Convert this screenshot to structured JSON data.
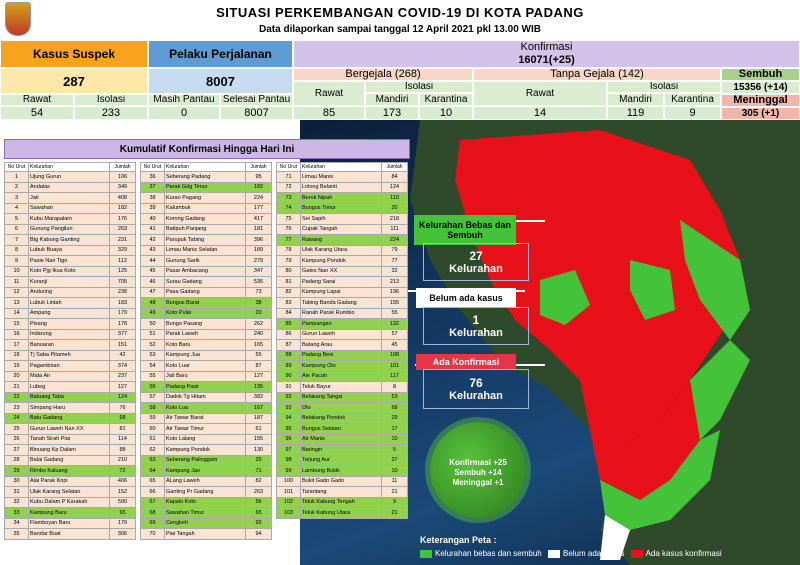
{
  "header": {
    "title": "SITUASI PERKEMBANGAN COVID-19 DI KOTA PADANG",
    "subtitle": "Data dilaporkan sampai tanggal 12 April 2021 pkl 13.00 WIB"
  },
  "stats": {
    "suspek_label": "Kasus Suspek",
    "suspek_value": "287",
    "rawat_label": "Rawat",
    "rawat_value": "54",
    "isolasi_label": "Isolasi",
    "isolasi_value": "233",
    "pp_label": "Pelaku Perjalanan",
    "pp_value": "8007",
    "masih_label": "Masih Pantau",
    "masih_value": "0",
    "selesai_label": "Selesai Pantau",
    "selesai_value": "8007",
    "konf_label": "Konfirmasi",
    "konf_value": "16071(+25)",
    "bergejala_label": "Bergejala (268)",
    "tanpa_label": "Tanpa Gejala (142)",
    "bg_rawat_label": "Rawat",
    "bg_isolasi_label": "Isolasi",
    "bg_mandiri_label": "Mandiri",
    "bg_karantina_label": "Karantina",
    "bg_rawat": "85",
    "bg_mandiri": "173",
    "bg_karantina": "10",
    "tg_rawat_label": "Rawat",
    "tg_isolasi_label": "Isolasi",
    "tg_mandiri_label": "Mandiri",
    "tg_karantina_label": "Karantina",
    "tg_rawat": "14",
    "tg_mandiri": "119",
    "tg_karantina": "9",
    "sembuh_label": "Sembuh",
    "sembuh_value": "15356 (+14)",
    "meninggal_label": "Meninggal",
    "meninggal_value": "305 (+1)"
  },
  "table": {
    "title": "Kumulatif Konfirmasi Hingga Hari Ini",
    "col_no": "No Urut",
    "col_kel": "Kelurahan",
    "col_jml": "Jumlah",
    "rows": [
      [
        "1",
        "Ujung Gurun",
        "106",
        0
      ],
      [
        "2",
        "Andalas",
        "349",
        0
      ],
      [
        "3",
        "Jati",
        "408",
        0
      ],
      [
        "4",
        "Sawahan",
        "182",
        0
      ],
      [
        "5",
        "Kubu Marapalam",
        "176",
        0
      ],
      [
        "6",
        "Gunung Pangilun",
        "263",
        0
      ],
      [
        "7",
        "Btg Kabung Ganting",
        "231",
        0
      ],
      [
        "8",
        "Lubuk Buaya",
        "329",
        0
      ],
      [
        "9",
        "Pasie Nan Tigo",
        "112",
        0
      ],
      [
        "10",
        "Koto Pjg Ikua Koto",
        "125",
        0
      ],
      [
        "11",
        "Kuranji",
        "705",
        0
      ],
      [
        "12",
        "Anduring",
        "238",
        0
      ],
      [
        "13",
        "Lubuk Lintah",
        "183",
        0
      ],
      [
        "14",
        "Ampang",
        "179",
        0
      ],
      [
        "15",
        "Pisang",
        "178",
        0
      ],
      [
        "16",
        "Indarung",
        "377",
        0
      ],
      [
        "17",
        "Banuaran",
        "151",
        0
      ],
      [
        "18",
        "Tj Saba Pitameh",
        "42",
        0
      ],
      [
        "19",
        "Pagambiran",
        "374",
        0
      ],
      [
        "20",
        "Mata Air",
        "237",
        0
      ],
      [
        "21",
        "Lubeg",
        "127",
        0
      ],
      [
        "22",
        "Batuang Taba",
        "124",
        1
      ],
      [
        "23",
        "Simpang Haru",
        "76",
        0
      ],
      [
        "24",
        "Batu Gadang",
        "68",
        1
      ],
      [
        "25",
        "Gurun Laweh Nan XX",
        "81",
        0
      ],
      [
        "26",
        "Tanah Sirah Piai",
        "114",
        0
      ],
      [
        "27",
        "Binuang Kp Dalam",
        "88",
        0
      ],
      [
        "28",
        "Balai Gadang",
        "210",
        0
      ],
      [
        "29",
        "Rimbo Kaluang",
        "72",
        1
      ],
      [
        "30",
        "Alai Parak Kopi",
        "406",
        0
      ],
      [
        "31",
        "Ulak Karang Selatan",
        "152",
        0
      ],
      [
        "32",
        "Kubu Dalam P Karakah",
        "590",
        0
      ],
      [
        "33",
        "Kampung Baru",
        "65",
        1
      ],
      [
        "34",
        "Flamboyan Baru",
        "179",
        0
      ],
      [
        "35",
        "Bandar Buat",
        "306",
        0
      ],
      [
        "36",
        "Seberang Padang",
        "95",
        0
      ],
      [
        "37",
        "Parak Gdg Timur",
        "182",
        1
      ],
      [
        "38",
        "Kurao Pagang",
        "224",
        0
      ],
      [
        "39",
        "Kalumbuk",
        "177",
        0
      ],
      [
        "40",
        "Korong Gadang",
        "417",
        0
      ],
      [
        "41",
        "Batipuh Panjang",
        "181",
        0
      ],
      [
        "42",
        "Parupuk Tabing",
        "396",
        0
      ],
      [
        "43",
        "Limau Manis Selatan",
        "189",
        0
      ],
      [
        "44",
        "Gunung Sarik",
        "279",
        0
      ],
      [
        "45",
        "Pasar Ambacang",
        "347",
        0
      ],
      [
        "46",
        "Surau Gadang",
        "536",
        0
      ],
      [
        "47",
        "Pasa Gadang",
        "73",
        0
      ],
      [
        "48",
        "Bungus Barat",
        "38",
        1
      ],
      [
        "49",
        "Koto Pulai",
        "20",
        1
      ],
      [
        "50",
        "Bungo Pasang",
        "262",
        0
      ],
      [
        "51",
        "Parak Laweh",
        "240",
        0
      ],
      [
        "52",
        "Koto Baru",
        "165",
        0
      ],
      [
        "53",
        "Kampung Jua",
        "55",
        0
      ],
      [
        "54",
        "Koto Luar",
        "87",
        0
      ],
      [
        "55",
        "Jati Baru",
        "127",
        0
      ],
      [
        "56",
        "Padang Pasir",
        "135",
        1
      ],
      [
        "57",
        "Dadok Tg Hitam",
        "382",
        0
      ],
      [
        "58",
        "Koto Lua",
        "167",
        1
      ],
      [
        "59",
        "Air Tawar Barat",
        "187",
        0
      ],
      [
        "60",
        "Air Tawar Timur",
        "61",
        0
      ],
      [
        "61",
        "Koto Lalang",
        "155",
        0
      ],
      [
        "62",
        "Kampung Pondok",
        "130",
        0
      ],
      [
        "63",
        "Seberang Palinggam",
        "25",
        1
      ],
      [
        "64",
        "Kampung Jao",
        "71",
        1
      ],
      [
        "65",
        "ALang Laweh",
        "82",
        0
      ],
      [
        "66",
        "Ganting Pr Gadang",
        "263",
        0
      ],
      [
        "67",
        "Kapalo Koto",
        "56",
        1
      ],
      [
        "68",
        "Sawahan Timur",
        "65",
        1
      ],
      [
        "69",
        "Cengkeh",
        "92",
        1
      ],
      [
        "70",
        "Piai Tangah",
        "94",
        0
      ],
      [
        "71",
        "Limau Manis",
        "84",
        0
      ],
      [
        "72",
        "Lolong Belanti",
        "124",
        0
      ],
      [
        "73",
        "Berok Nipah",
        "110",
        1
      ],
      [
        "74",
        "Bungus Timur",
        "20",
        1
      ],
      [
        "75",
        "Sei Sapih",
        "218",
        0
      ],
      [
        "76",
        "Cupak Tangah",
        "111",
        0
      ],
      [
        "77",
        "Rawang",
        "224",
        1
      ],
      [
        "78",
        "Ulak Karang Utara",
        "79",
        0
      ],
      [
        "79",
        "Kampung Pondok",
        "77",
        0
      ],
      [
        "80",
        "Gates Nan XX",
        "32",
        0
      ],
      [
        "81",
        "Padang Sarai",
        "213",
        0
      ],
      [
        "82",
        "Kampung Lapai",
        "196",
        0
      ],
      [
        "83",
        "Tabing Banda Gadang",
        "155",
        0
      ],
      [
        "84",
        "Ranah Parak Rumbio",
        "55",
        0
      ],
      [
        "85",
        "Pampangan",
        "132",
        1
      ],
      [
        "86",
        "Gurun Laweh",
        "57",
        0
      ],
      [
        "87",
        "Batang Arau",
        "45",
        0
      ],
      [
        "88",
        "Padang Besi",
        "108",
        1
      ],
      [
        "89",
        "Kampung Olo",
        "101",
        1
      ],
      [
        "90",
        "Aie Pacah",
        "117",
        1
      ],
      [
        "91",
        "Teluk Bayur",
        "8",
        0
      ],
      [
        "92",
        "Belakang Tangsi",
        "53",
        1
      ],
      [
        "93",
        "Olo",
        "68",
        1
      ],
      [
        "94",
        "Belakang Pondok",
        "29",
        1
      ],
      [
        "95",
        "Bungus Selatan",
        "17",
        1
      ],
      [
        "96",
        "Air Manis",
        "10",
        1
      ],
      [
        "97",
        "Baringin",
        "5",
        1
      ],
      [
        "98",
        "Tarjung Aur",
        "27",
        1
      ],
      [
        "99",
        "Lambung Bukik",
        "10",
        1
      ],
      [
        "100",
        "Bukit Gado Gado",
        "11",
        0
      ],
      [
        "101",
        "Tarantang",
        "21",
        0
      ],
      [
        "102",
        "Teluk Kabung Tengah",
        "9",
        1
      ],
      [
        "103",
        "Teluk Kabung Utara",
        "21",
        1
      ]
    ]
  },
  "status": {
    "bebas_label": "Kelurahan Bebas dan Sembuh",
    "bebas_value": "27",
    "bebas_unit": "Kelurahan",
    "belum_label": "Belum ada kasus",
    "belum_value": "1",
    "belum_unit": "Kelurahan",
    "ada_label": "Ada Konfirmasi",
    "ada_value": "76",
    "ada_unit": "Kelurahan"
  },
  "virus": {
    "l1": "Konfirmasi +25",
    "l2": "Sembuh +14",
    "l3": "Meninggal +1"
  },
  "legend": {
    "title": "Keterangan Peta :",
    "i1": "Kelurahan bebas dan sembuh",
    "i2": "Belum ada kasus",
    "i3": "Ada kasus konfirmasi"
  },
  "colors": {
    "green": "#44c23a",
    "white": "#ffffff",
    "red": "#e8111a"
  }
}
